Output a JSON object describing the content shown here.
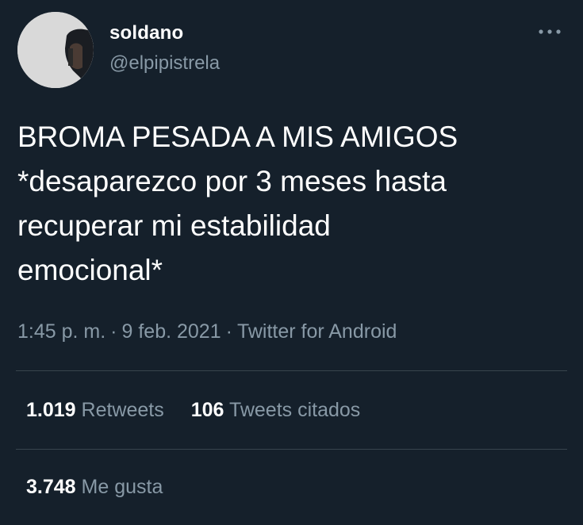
{
  "colors": {
    "background": "#15202b",
    "primary_text": "#ffffff",
    "secondary_text": "#8899a6",
    "divider": "#38444d"
  },
  "author": {
    "display_name": "soldano",
    "handle": "@elpipistrela",
    "avatar_icon": "avatar-image",
    "more_icon": "more-horizontal-icon"
  },
  "tweet": {
    "text": "BROMA PESADA A MIS AMIGOS\n*desaparezco por 3 meses hasta\nrecuperar mi estabilidad\nemocional*",
    "time": "1:45 p. m.",
    "separator": "·",
    "date": "9 feb. 2021",
    "source": "Twitter for Android"
  },
  "stats": {
    "retweets_count": "1.019",
    "retweets_label": "Retweets",
    "quotes_count": "106",
    "quotes_label": "Tweets citados",
    "likes_count": "3.748",
    "likes_label": "Me gusta"
  }
}
